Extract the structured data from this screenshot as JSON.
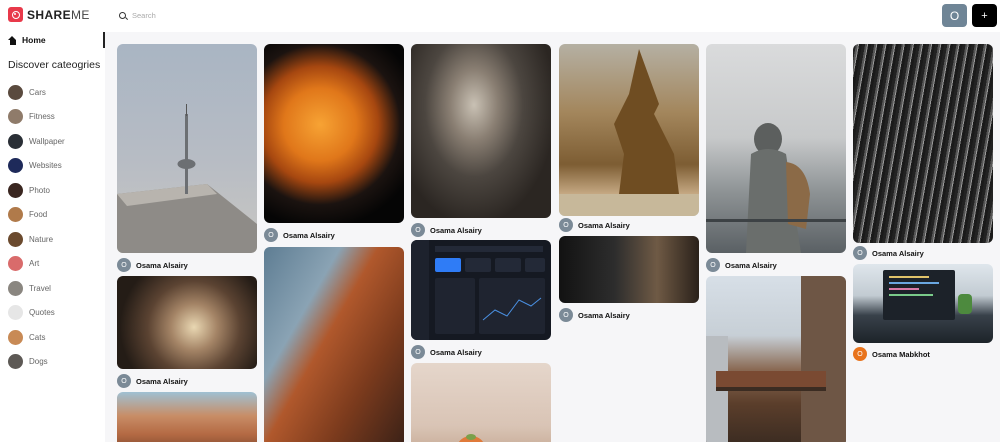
{
  "app": {
    "logo_text_strong": "SHARE",
    "logo_text_light": "ME"
  },
  "nav": {
    "home_label": "Home"
  },
  "sidebar": {
    "discover_title": "Discover cateogries",
    "categories": [
      {
        "label": "Cars",
        "color": "#5a4a3e"
      },
      {
        "label": "Fitness",
        "color": "#8f7b6a"
      },
      {
        "label": "Wallpaper",
        "color": "#2a2f36"
      },
      {
        "label": "Websites",
        "color": "#1e2a5a"
      },
      {
        "label": "Photo",
        "color": "#3a2620"
      },
      {
        "label": "Food",
        "color": "#b07a4a"
      },
      {
        "label": "Nature",
        "color": "#6b4a2e"
      },
      {
        "label": "Art",
        "color": "#d96b6b"
      },
      {
        "label": "Travel",
        "color": "#8a8680"
      },
      {
        "label": "Quotes",
        "color": "#e6e6e6"
      },
      {
        "label": "Cats",
        "color": "#c88a55"
      },
      {
        "label": "Dogs",
        "color": "#5d5955"
      }
    ]
  },
  "header": {
    "search_placeholder": "Search",
    "user_initial": "O",
    "add_label": "+"
  },
  "pins": [
    {
      "user_initial": "O",
      "user_name": "Osama Alsairy"
    },
    {
      "user_initial": "O",
      "user_name": "Osama Alsairy"
    },
    {
      "user_initial": "O",
      "user_name": "Osama Alsairy"
    },
    {
      "user_initial": "O",
      "user_name": "Osama Alsairy"
    },
    {
      "user_initial": "O",
      "user_name": "Osama Alsairy"
    },
    {
      "user_initial": "O",
      "user_name": "Osama Alsairy"
    },
    {
      "user_initial": "O",
      "user_name": "Osama Alsairy"
    },
    {
      "user_initial": "O",
      "user_name": "Osama Alsairy"
    },
    {
      "user_initial": "O",
      "user_name": "Osama Alsairy"
    },
    {
      "user_initial": "O",
      "user_name": "Osama Mabkhot"
    }
  ]
}
